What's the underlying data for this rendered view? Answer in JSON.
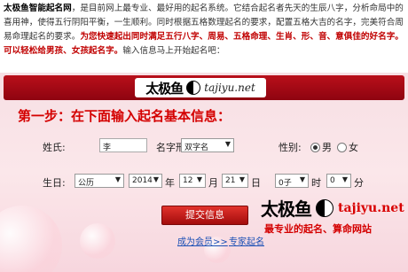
{
  "intro": {
    "brand": "太极鱼智能起名网",
    "text1": "，是目前网上最专业、最好用的起名系统。它结合起名者先天的生辰八字，分析命局中的喜用神，使得五行阴阳平衡，一生顺利。同时根据五格数理起名的要求，配置五格大吉的名字，完美符合周易命理起名的要求。",
    "highlight": "为您快速起出同时满足五行八字、周易、五格命理、生肖、形、音、意俱佳的好名字。可以轻松给男孩、女孩起名字。",
    "text2": "输入信息马上开始起名吧："
  },
  "header": {
    "logo_chars": "太极鱼",
    "logo_url": "tajiyu.net"
  },
  "form": {
    "step_title": "第一步：在下面输入起名基本信息：",
    "surname_label": "姓氏:",
    "surname_value": "李",
    "style_label": "名字形式:",
    "style_value": "双字名",
    "gender_label": "性别:",
    "gender_male": "男",
    "gender_female": "女",
    "birth_label": "生日:",
    "calendar_value": "公历",
    "year_value": "2014",
    "year_unit": "年",
    "month_value": "12",
    "month_unit": "月",
    "day_value": "21",
    "day_unit": "日",
    "hour_value": "0子",
    "hour_unit": "时",
    "minute_value": "0",
    "minute_unit": "分",
    "submit_label": "提交信息"
  },
  "footer": {
    "member_link": "成为会员>>",
    "expert_link": "专家起名",
    "brand_chars": "太极鱼",
    "brand_url": "tajiyu.net",
    "slogan": "最专业的起名、算命网站"
  },
  "colors": {
    "accent_red": "#c00000",
    "header_red": "#a50a14",
    "link_blue": "#1a4fb5"
  }
}
